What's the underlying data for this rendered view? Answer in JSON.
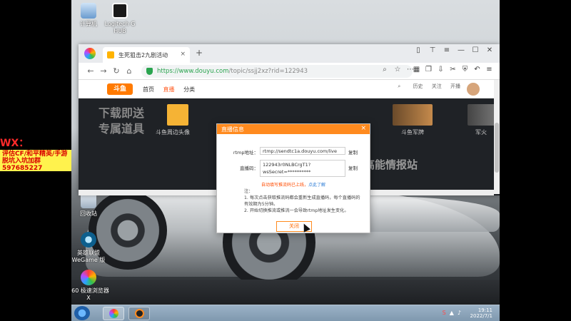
{
  "desktop": {
    "icons": [
      {
        "label": "计算机"
      },
      {
        "label": "Logitech G HUB"
      },
      {
        "label": "回收站"
      },
      {
        "label": "英雄联盟 WeGame 版"
      },
      {
        "label": "360 极速浏览器X"
      }
    ]
  },
  "browser": {
    "tab_title": "生死狙击2九剧活动",
    "url_host": "https://www.douyu.com",
    "url_path": "/topic/ssjj2xz?rid=122943",
    "tab_close": "×",
    "new_tab": "+"
  },
  "site": {
    "logo_text": "斗鱼",
    "nav": [
      "首页",
      "直播",
      "分类"
    ],
    "active_nav": "直播",
    "tools": [
      "历史",
      "关注",
      "开播"
    ],
    "banner_lines": [
      "下载即送",
      "专属道具"
    ],
    "thumb_captions": [
      "斗鱼周边头像",
      "斗鱼军牌",
      "军火"
    ],
    "highlight_text": "高能情报站"
  },
  "overlay": {
    "red_text": "WX：ssj122943",
    "yellow_lines": [
      "评估CF/和平精英/手游",
      "脱坑入坑加群597685227"
    ]
  },
  "modal": {
    "title": "直播信息",
    "close_icon": "×",
    "rtmp_label": "rtmp地址：",
    "rtmp_value": "rtmp://sendtc1a.douyu.com/live",
    "key_label": "直播码：",
    "key_value": "122943r0NLBCrgT1?wsSecret=**********",
    "key_value2": "",
    "copy_label": "复制",
    "auto_text": "自动填写推流码已上线，",
    "auto_link": "点此了解",
    "notes_title": "注：",
    "notes": [
      "1. 每次点击获取推流码都会重新生成直播码，每个直播码的有效期为5分钟。",
      "2. 开始切换推流或推流一会导致rtmp地址发生变化。"
    ],
    "close_button": "关闭"
  },
  "taskbar": {
    "time": "19:11",
    "date": "2022/7/1"
  }
}
